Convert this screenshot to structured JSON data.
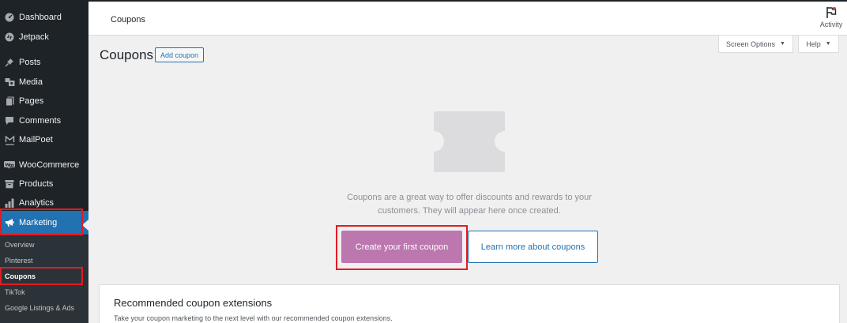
{
  "sidebar": {
    "items": [
      {
        "label": "Dashboard",
        "icon": "dashboard-icon"
      },
      {
        "label": "Jetpack",
        "icon": "jetpack-icon"
      },
      {
        "label": "Posts",
        "icon": "pin-icon"
      },
      {
        "label": "Media",
        "icon": "media-icon"
      },
      {
        "label": "Pages",
        "icon": "pages-icon"
      },
      {
        "label": "Comments",
        "icon": "comment-icon"
      },
      {
        "label": "MailPoet",
        "icon": "mailpoet-icon"
      },
      {
        "label": "WooCommerce",
        "icon": "woo-icon"
      },
      {
        "label": "Products",
        "icon": "archive-icon"
      },
      {
        "label": "Analytics",
        "icon": "bar-chart-icon"
      },
      {
        "label": "Marketing",
        "icon": "megaphone-icon"
      }
    ],
    "submenu": [
      "Overview",
      "Pinterest",
      "Coupons",
      "TikTok",
      "Google Listings & Ads"
    ]
  },
  "topbar": {
    "title": "Coupons",
    "activity_label": "Activity"
  },
  "screen_options": "Screen Options",
  "help": "Help",
  "page": {
    "heading": "Coupons",
    "add_coupon": "Add coupon"
  },
  "empty_state": {
    "message": "Coupons are a great way to offer discounts and rewards to your customers. They will appear here once created.",
    "create_button": "Create your first coupon",
    "learn_button": "Learn more about coupons"
  },
  "recommended": {
    "title": "Recommended coupon extensions",
    "subtitle": "Take your coupon marketing to the next level with our recommended coupon extensions."
  },
  "colors": {
    "sidebar_bg": "#1d2327",
    "accent": "#2271b1",
    "woo_purple": "#bb77ae",
    "highlight_red": "#e31b23"
  }
}
